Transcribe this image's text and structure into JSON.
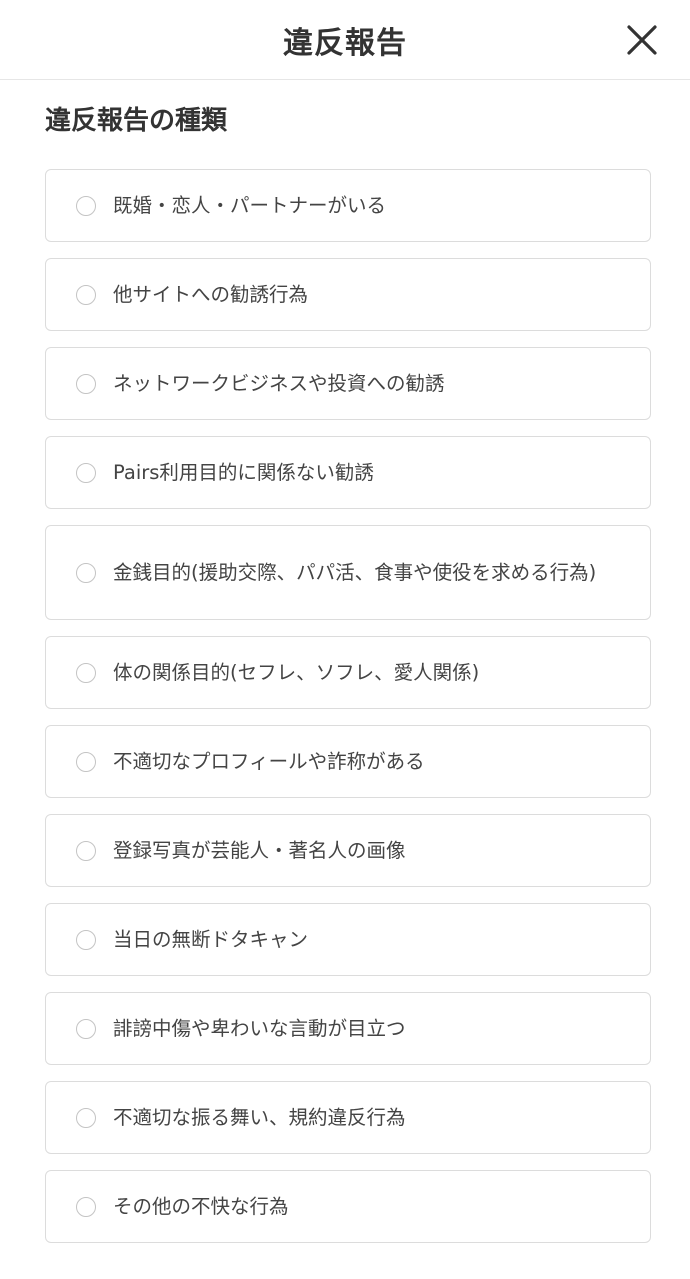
{
  "header": {
    "title": "違反報告"
  },
  "section": {
    "title": "違反報告の種類"
  },
  "options": [
    {
      "label": "既婚・恋人・パートナーがいる"
    },
    {
      "label": "他サイトへの勧誘行為"
    },
    {
      "label": "ネットワークビジネスや投資への勧誘"
    },
    {
      "label": "Pairs利用目的に関係ない勧誘"
    },
    {
      "label": "金銭目的(援助交際、パパ活、食事や使役を求める行為)"
    },
    {
      "label": "体の関係目的(セフレ、ソフレ、愛人関係)"
    },
    {
      "label": "不適切なプロフィールや詐称がある"
    },
    {
      "label": "登録写真が芸能人・著名人の画像"
    },
    {
      "label": "当日の無断ドタキャン"
    },
    {
      "label": "誹謗中傷や卑わいな言動が目立つ"
    },
    {
      "label": "不適切な振る舞い、規約違反行為"
    },
    {
      "label": "その他の不快な行為"
    }
  ],
  "colors": {
    "text": "#333333",
    "border": "#dcdcdc",
    "radio": "#c4c4c4"
  }
}
